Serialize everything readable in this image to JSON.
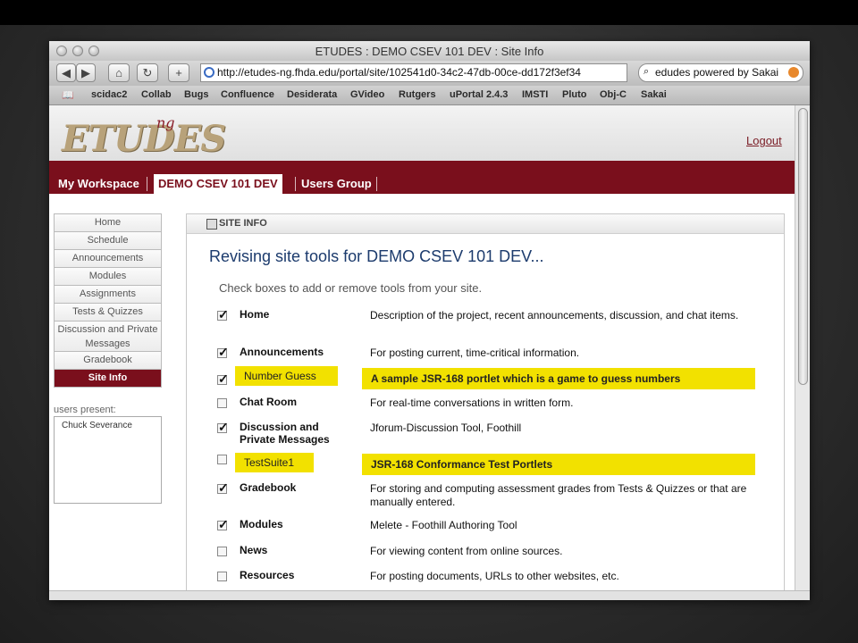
{
  "window": {
    "title": "ETUDES : DEMO CSEV 101 DEV : Site Info"
  },
  "toolbar": {
    "url": "http://etudes-ng.fhda.edu/portal/site/102541d0-34c2-47db-00ce-dd172f3ef34",
    "search_value": "edudes powered by Sakai",
    "back_icon": "back-arrow",
    "forward_icon": "forward-arrow",
    "home_icon": "home",
    "reload_icon": "reload",
    "add_icon": "plus"
  },
  "bookmarks": [
    "scidac2",
    "Collab",
    "Bugs",
    "Confluence",
    "Desiderata",
    "GVideo",
    "Rutgers",
    "uPortal 2.4.3",
    "IMSTI",
    "Pluto",
    "Obj-C",
    "Sakai"
  ],
  "header": {
    "logo": "ETUDES",
    "logo_suffix": "ng",
    "logout": "Logout"
  },
  "nav": {
    "tabs": [
      "My Workspace",
      "DEMO CSEV 101 DEV",
      "Users Group"
    ],
    "selected": "DEMO CSEV 101 DEV"
  },
  "left_menu": {
    "items": [
      "Home",
      "Schedule",
      "Announcements",
      "Modules",
      "Assignments",
      "Tests & Quizzes",
      "Discussion and Private Messages",
      "Gradebook",
      "Site Info"
    ],
    "selected": "Site Info"
  },
  "users_present": {
    "label": "users present:",
    "users": [
      "Chuck Severance"
    ]
  },
  "panel": {
    "header": "SITE INFO",
    "heading": "Revising site tools for DEMO CSEV 101 DEV...",
    "instructions": "Check boxes to add or remove tools from your site.",
    "tools": [
      {
        "name": "Home",
        "desc": "Description of the project, recent announcements, discussion, and chat items.",
        "checked": true,
        "highlight": false
      },
      {
        "name": "Announcements",
        "desc": "For posting current, time-critical information.",
        "checked": true,
        "highlight": false
      },
      {
        "name": "Number Guess",
        "desc": "A sample JSR-168 portlet which is a game to guess numbers",
        "checked": true,
        "highlight": true
      },
      {
        "name": "Chat Room",
        "desc": "For real-time conversations in written form.",
        "checked": false,
        "highlight": false
      },
      {
        "name": "Discussion and Private Messages",
        "desc": "Jforum-Discussion Tool, Foothill",
        "checked": true,
        "highlight": false
      },
      {
        "name": "TestSuite1",
        "desc": "JSR-168 Conformance Test Portlets",
        "checked": false,
        "highlight": true
      },
      {
        "name": "Gradebook",
        "desc": "For storing and computing assessment grades from Tests & Quizzes or that are manually entered.",
        "checked": true,
        "highlight": false
      },
      {
        "name": "Modules",
        "desc": "Melete - Foothill Authoring Tool",
        "checked": true,
        "highlight": false
      },
      {
        "name": "News",
        "desc": "For viewing content from online sources.",
        "checked": false,
        "highlight": false
      },
      {
        "name": "Resources",
        "desc": "For posting documents, URLs to other websites, etc.",
        "checked": false,
        "highlight": false
      }
    ]
  },
  "colors": {
    "brand": "#7a0f1c",
    "highlight": "#f2e100",
    "heading": "#1c3b6d"
  }
}
